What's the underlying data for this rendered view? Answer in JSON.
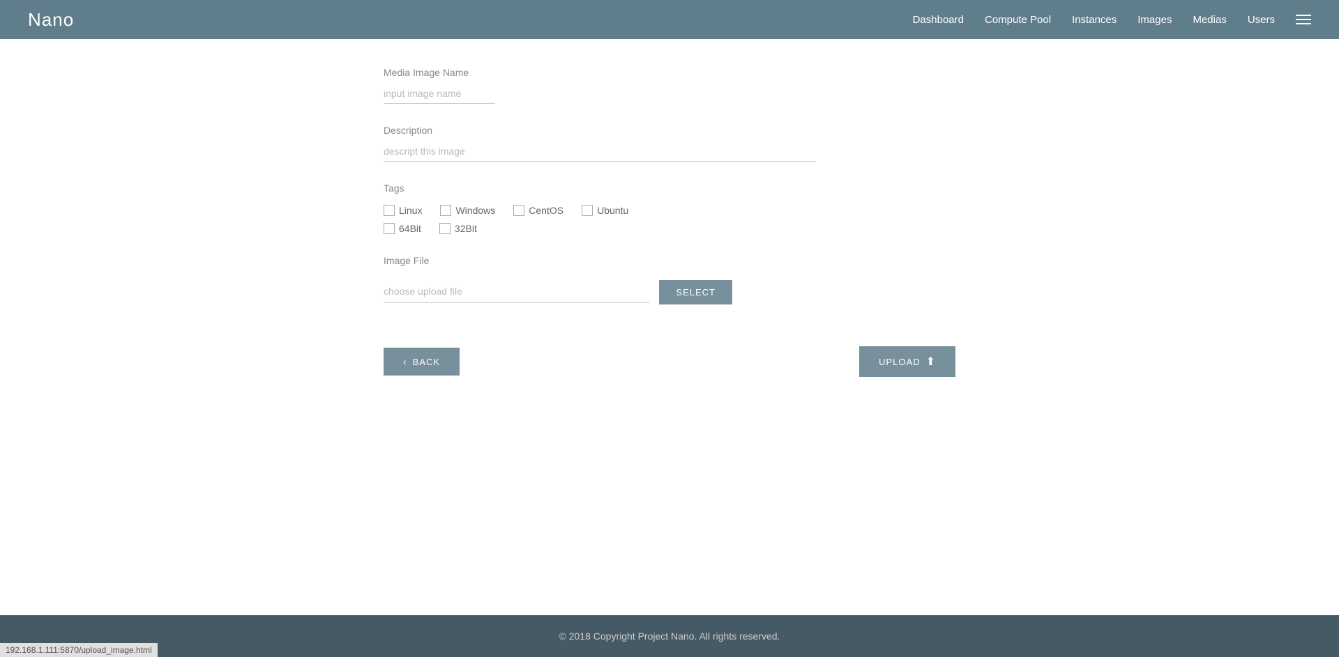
{
  "header": {
    "logo": "Nano",
    "nav": {
      "dashboard": "Dashboard",
      "compute_pool": "Compute Pool",
      "instances": "Instances",
      "images": "Images",
      "medias": "Medias",
      "users": "Users"
    }
  },
  "form": {
    "media_image_name_label": "Media Image Name",
    "media_image_name_placeholder": "input image name",
    "description_label": "Description",
    "description_placeholder": "descript this image",
    "tags_label": "Tags",
    "tags": [
      {
        "id": "linux",
        "label": "Linux"
      },
      {
        "id": "windows",
        "label": "Windows"
      },
      {
        "id": "centos",
        "label": "CentOS"
      },
      {
        "id": "ubuntu",
        "label": "Ubuntu"
      },
      {
        "id": "64bit",
        "label": "64Bit"
      },
      {
        "id": "32bit",
        "label": "32Bit"
      }
    ],
    "image_file_label": "Image File",
    "file_placeholder": "choose upload file",
    "select_btn": "SELECT"
  },
  "actions": {
    "back_label": "BACK",
    "upload_label": "UPLOAD"
  },
  "footer": {
    "copyright": "© 2018 Copyright Project Nano. All rights reserved."
  },
  "status_bar": {
    "url": "192.168.1.111:5870/upload_image.html"
  }
}
